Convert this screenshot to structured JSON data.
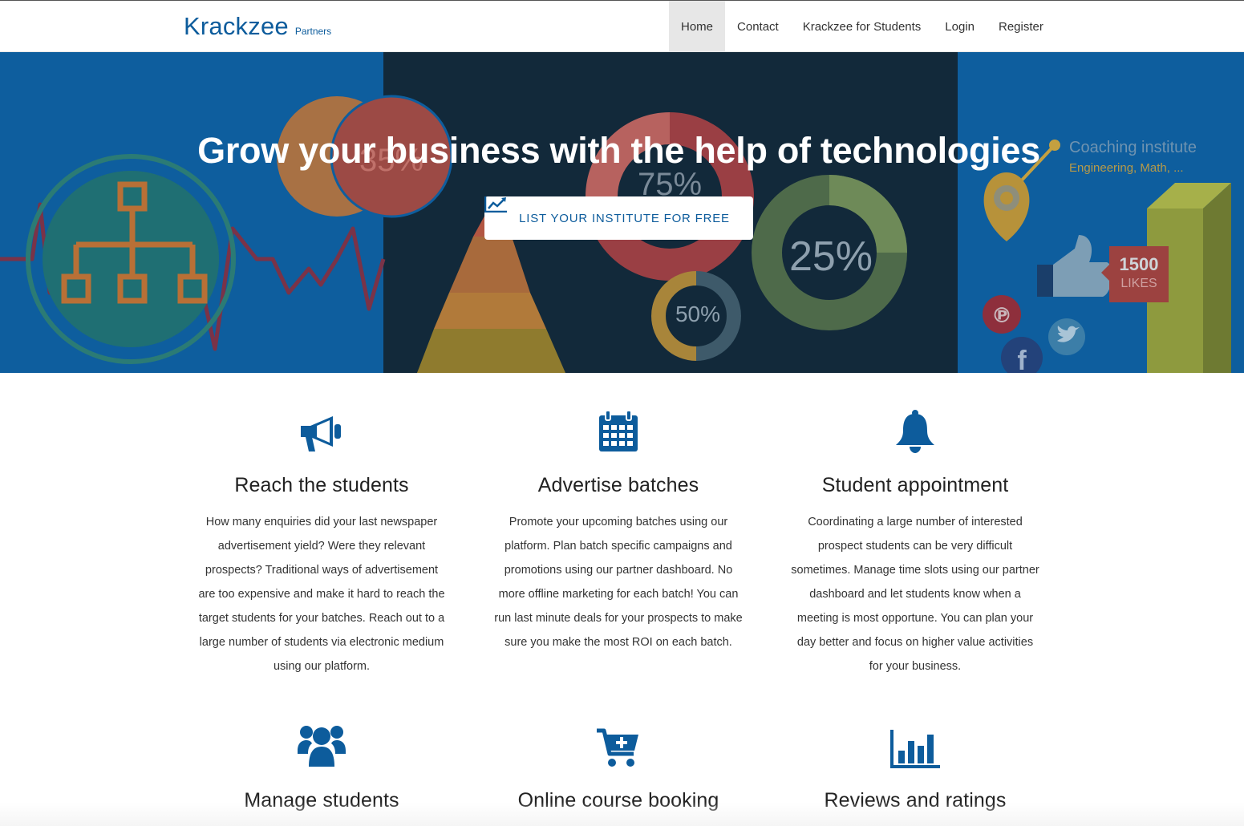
{
  "brand": {
    "name": "Krackzee",
    "subtitle": "Partners"
  },
  "nav": {
    "items": [
      {
        "label": "Home",
        "active": true
      },
      {
        "label": "Contact",
        "active": false
      },
      {
        "label": "Krackzee for Students",
        "active": false
      },
      {
        "label": "Login",
        "active": false
      },
      {
        "label": "Register",
        "active": false
      }
    ]
  },
  "hero": {
    "title": "Grow your business with the help of technologies",
    "cta_label": "LIST YOUR INSTITUTE FOR FREE",
    "cta_icon": "line-chart-icon",
    "graphic_texts": {
      "pct_75": "75%",
      "pct_25": "25%",
      "pct_50": "50%",
      "pct_35": "35%",
      "coaching_title": "Coaching institute",
      "coaching_sub": "Engineering, Math, ...",
      "likes_count": "1500",
      "likes_label": "LIKES"
    }
  },
  "features": [
    {
      "icon": "megaphone-icon",
      "title": "Reach the students",
      "text": "How many enquiries did your last newspaper advertisement yield? Were they relevant prospects? Traditional ways of advertisement are too expensive and make it hard to reach the target students for your batches. Reach out to a large number of students via electronic medium using our platform."
    },
    {
      "icon": "calendar-icon",
      "title": "Advertise batches",
      "text": "Promote your upcoming batches using our platform. Plan batch specific campaigns and promotions using our partner dashboard. No more offline marketing for each batch! You can run last minute deals for your prospects to make sure you make the most ROI on each batch."
    },
    {
      "icon": "bell-icon",
      "title": "Student appointment",
      "text": "Coordinating a large number of interested prospect students can be very difficult sometimes. Manage time slots using our partner dashboard and let students know when a meeting is most opportune. You can plan your day better and focus on higher value activities for your business."
    },
    {
      "icon": "users-icon",
      "title": "Manage students",
      "text": ""
    },
    {
      "icon": "cart-plus-icon",
      "title": "Online course booking",
      "text": ""
    },
    {
      "icon": "bar-chart-icon",
      "title": "Reviews and ratings",
      "text": ""
    }
  ],
  "colors": {
    "brand": "#0d5c9c",
    "hero_bg": "#0e5e9e",
    "hero_dark": "#12293a",
    "nav_active": "#e7e7e7"
  }
}
